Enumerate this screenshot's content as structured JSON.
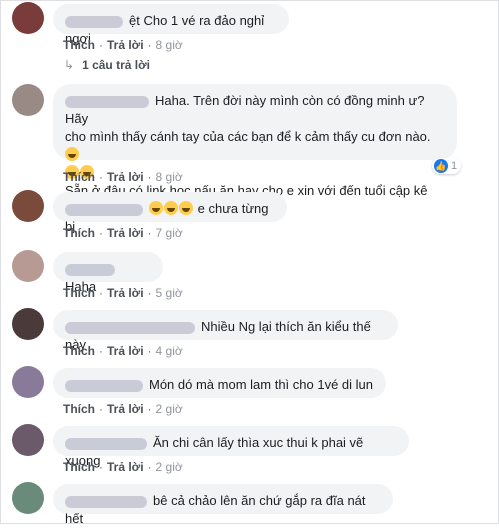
{
  "action_labels": {
    "like": "Thích",
    "reply": "Trả lời"
  },
  "comments": [
    {
      "text": "ệt Cho 1 vé ra đảo nghỉ ngơi",
      "time": "8 giờ",
      "avatar_color": "#7a3b3b"
    },
    {
      "line1": "Haha. Trên đời này mình còn có đồng minh ư? Hãy",
      "line2": "cho mình thấy cánh tay của các bạn để k cảm thấy cu đơn nào.",
      "line3": "Sẵn ở đâu có link học nấu ăn hay cho e xin với đến tuổi cập kê rồi..",
      "time": "8 giờ",
      "like_count": "1",
      "avatar_color": "#9a8a86"
    },
    {
      "text": "e chưa từng bị",
      "time": "7 giờ",
      "avatar_color": "#7a4a3a"
    },
    {
      "text": "Haha",
      "time": "5 giờ",
      "avatar_color": "#b89a94"
    },
    {
      "text": "Nhiều Ng lại thích ăn kiểu thế này",
      "time": "4 giờ",
      "avatar_color": "#4a3a3a"
    },
    {
      "text": "Món dó mà mom lam thì cho 1vé di lun",
      "time": "2 giờ",
      "avatar_color": "#8a7a9a"
    },
    {
      "text": "Ăn chi cân lấy thìa xuc thui k phai vẽ xuong",
      "time": "2 giờ",
      "avatar_color": "#6a5a6a"
    },
    {
      "text": "bê cả chảo lên ăn chứ gắp ra đĩa nát hết",
      "time": "",
      "avatar_color": "#6a8a7a"
    }
  ],
  "reply_count_label": "1 câu trả lời"
}
